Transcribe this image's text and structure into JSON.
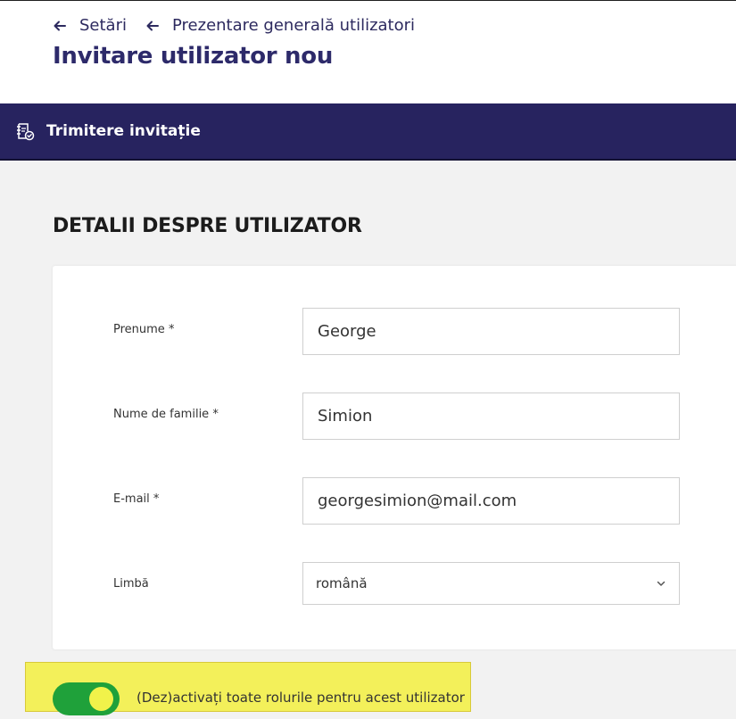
{
  "breadcrumbs": [
    {
      "label": "Setări",
      "icon": "arrow-left-icon"
    },
    {
      "label": "Prezentare generală utilizatori",
      "icon": "arrow-left-icon"
    }
  ],
  "page_title": "Invitare utilizator nou",
  "tab": {
    "label": "Trimitere invitație",
    "icon": "invitation-document-icon"
  },
  "section_title": "DETALII DESPRE UTILIZATOR",
  "form": {
    "first_name": {
      "label": "Prenume *",
      "value": "George"
    },
    "last_name": {
      "label": "Nume de familie *",
      "value": "Simion"
    },
    "email": {
      "label": "E-mail *",
      "value": "georgesimion@mail.com"
    },
    "language": {
      "label": "Limbă",
      "value": "română"
    }
  },
  "roles_toggle": {
    "label": "(Dez)activați toate rolurile pentru acest utilizator",
    "state": "on"
  },
  "colors": {
    "brand_dark": "#27235f",
    "title": "#2d2a6a",
    "toggle_on": "#1fa13a",
    "highlight": "#f3f05a"
  }
}
